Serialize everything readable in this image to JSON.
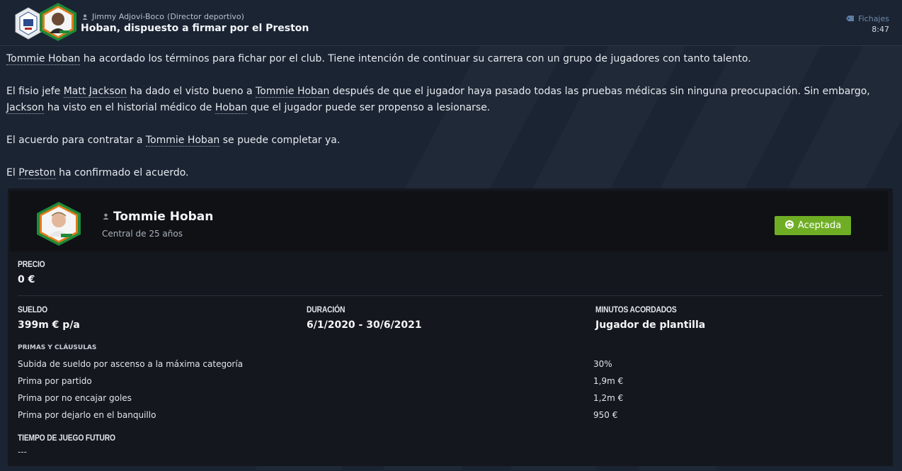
{
  "header": {
    "sender_name": "Jimmy Adjovi-Boco",
    "sender_role": "(Director deportivo)",
    "subject": "Hoban, dispuesto a firmar por el Preston",
    "category_label": "Fichajes",
    "time": "8:47"
  },
  "body": {
    "p1": {
      "name": "Tommie Hoban",
      "text": " ha acordado los términos para fichar por el club. Tiene intención de continuar su carrera con un grupo de jugadores con tanto talento."
    },
    "p2": {
      "t1": "El fisio jefe ",
      "physio": "Matt Jackson",
      "t2": " ha dado el visto bueno a ",
      "name": "Tommie Hoban",
      "t3": " después de que el jugador haya pasado todas las pruebas médicas sin ninguna preocupación. Sin embargo, ",
      "physio_short": "Jackson",
      "t4": " ha visto en el historial médico de ",
      "name_short": "Hoban",
      "t5": " que el jugador puede ser propenso a lesionarse."
    },
    "p3": {
      "t1": "El acuerdo para contratar a ",
      "name": "Tommie Hoban",
      "t2": " se puede completar ya."
    },
    "p4": {
      "t1": "El ",
      "club": "Preston",
      "t2": " ha confirmado el acuerdo."
    }
  },
  "card": {
    "player_name": "Tommie Hoban",
    "player_sub": "Central de 25 años",
    "status_button": "Aceptada",
    "price_label": "PRECIO",
    "price_value": "0 €",
    "salary_label": "SUELDO",
    "salary_value": "399m € p/a",
    "duration_label": "DURACIÓN",
    "duration_value": "6/1/2020 - 30/6/2021",
    "minutes_label": "MINUTOS ACORDADOS",
    "minutes_value": "Jugador de plantilla",
    "bonuses_label": "PRIMAS Y CLÁUSULAS",
    "bonuses": [
      {
        "label": "Subida de sueldo por ascenso a la máxima categoría",
        "value": "30%"
      },
      {
        "label": "Prima por partido",
        "value": "1,9m €"
      },
      {
        "label": "Prima por no encajar goles",
        "value": "1,2m €"
      },
      {
        "label": "Prima por dejarlo en el banquillo",
        "value": "950 €"
      }
    ],
    "future_label": "TIEMPO DE JUEGO FUTURO",
    "future_value": "---"
  },
  "icons": {
    "sender": "person-icon",
    "category": "tag-icon",
    "player": "person-icon",
    "button": "refresh-icon",
    "club_badge": "club-badge-icon",
    "sender_photo": "person-photo",
    "player_photo": "player-photo"
  },
  "colors": {
    "background": "#1b2433",
    "card": "#14171d",
    "accept_button": "#6fae24",
    "badge_green": "#1f8a3a",
    "badge_orange": "#e07b1a"
  }
}
